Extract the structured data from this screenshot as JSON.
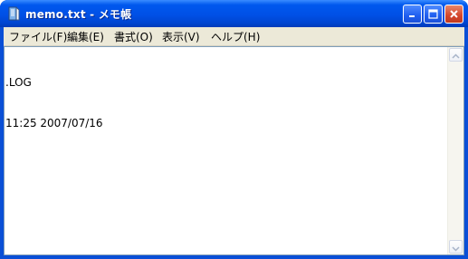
{
  "window": {
    "title": "memo.txt - メモ帳",
    "icon": "notepad-icon",
    "accent": "#0054e3",
    "close_color": "#d4462a"
  },
  "menubar": {
    "items": [
      "ファイル(F)",
      "編集(E)",
      "書式(O)",
      "表示(V)",
      "ヘルプ(H)"
    ]
  },
  "editor": {
    "lines": [
      ".LOG",
      "11:25 2007/07/16"
    ]
  },
  "scrollbar": {
    "up_icon": "scroll-up-arrow-icon",
    "down_icon": "scroll-down-arrow-icon"
  }
}
